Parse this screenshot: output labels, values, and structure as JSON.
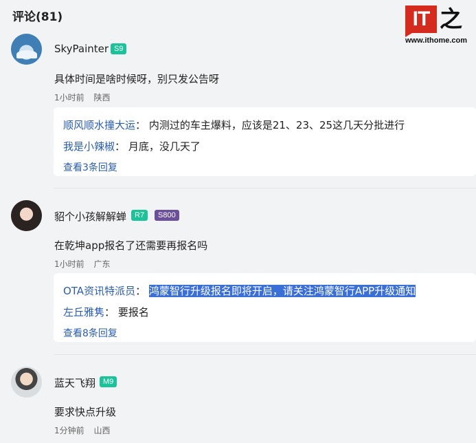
{
  "header": {
    "title": "评论(81)"
  },
  "logo": {
    "mark": "IT",
    "glyph": "之家",
    "url": "www.ithome.com"
  },
  "comments": [
    {
      "username": "SkyPainter",
      "badges": [
        "S9"
      ],
      "content": "具体时间是啥时候呀，别只发公告呀",
      "time": "1小时前",
      "location": "陕西",
      "replies": [
        {
          "author": "顺风顺水撞大运",
          "sep": "：",
          "text": "内测过的车主爆料，应该是21、23、25这几天分批进行"
        },
        {
          "author": "我是小辣椒",
          "sep": "：",
          "text": "月底，没几天了"
        }
      ],
      "more": "查看3条回复"
    },
    {
      "username": "貂个小孩解解蝉",
      "badges": [
        "R7",
        "S800"
      ],
      "content": "在乾坤app报名了还需要再报名吗",
      "time": "1小时前",
      "location": "广东",
      "replies": [
        {
          "author": "OTA资讯特派员",
          "sep": "：",
          "text": "鸿蒙智行升级报名即将开启，请关注鸿蒙智行APP升级通知"
        },
        {
          "author": "左丘雅隽",
          "sep": "：",
          "text": "要报名"
        }
      ],
      "more": "查看8条回复"
    },
    {
      "username": "蓝天飞翔",
      "badges": [
        "M9"
      ],
      "content": "要求快点升级",
      "time": "1分钟前",
      "location": "山西"
    }
  ],
  "colors": {
    "accent": "#2a5db0",
    "badge_green": "#1bc29a",
    "badge_purple": "#6b4f9a",
    "brand_red": "#d52b1e"
  }
}
